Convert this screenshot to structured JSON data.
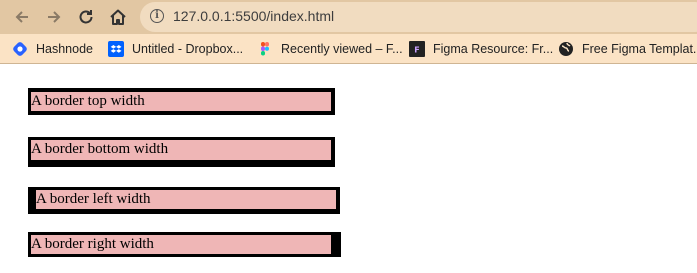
{
  "browser": {
    "url": "127.0.0.1:5500/index.html",
    "bookmarks": [
      {
        "label": "Hashnode",
        "icon": "hashnode-icon"
      },
      {
        "label": "Untitled - Dropbox...",
        "icon": "dropbox-icon"
      },
      {
        "label": "Recently viewed – F...",
        "icon": "figma-icon"
      },
      {
        "label": "Figma Resource: Fr...",
        "icon": "figma-resource-icon"
      },
      {
        "label": "Free Figma Templat...",
        "icon": "globe-icon"
      }
    ]
  },
  "demos": [
    {
      "text": "A border top width"
    },
    {
      "text": "A border bottom width"
    },
    {
      "text": "A border left width"
    },
    {
      "text": "A border right width"
    }
  ],
  "colors": {
    "toolbar": "#e2c7a3",
    "bookmarks_bar": "#fbe3c5",
    "box_fill": "#efb6b6",
    "border": "#000000"
  }
}
